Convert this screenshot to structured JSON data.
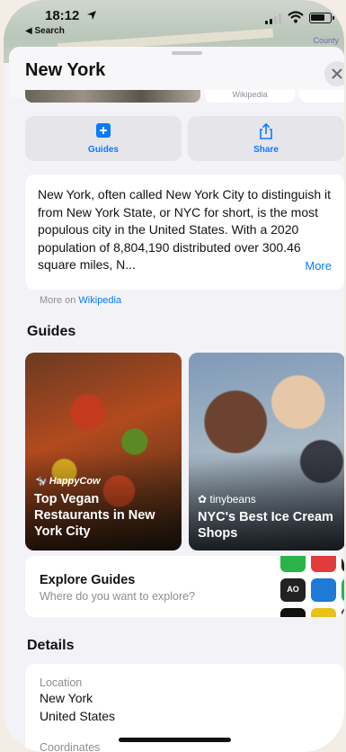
{
  "status_bar": {
    "time": "18:12",
    "back_label": "◀ Search"
  },
  "map": {
    "label": "County"
  },
  "place": {
    "title": "New York"
  },
  "photo_strip": {
    "credit": "Wikipedia"
  },
  "actions": [
    {
      "label": "Guides",
      "icon": "plus-square-icon"
    },
    {
      "label": "Share",
      "icon": "share-icon"
    }
  ],
  "about": {
    "text": "New York, often called New York City to distinguish it from New York State, or NYC for short, is the most populous city in the United States. With a 2020 population of 8,804,190 distributed over 300.46 square miles, N...",
    "more_label": "More",
    "source_prefix": "More on",
    "source_link": "Wikipedia"
  },
  "guides": {
    "heading": "Guides",
    "cards": [
      {
        "brand": "HappyCow",
        "title": "Top Vegan Restaurants in New York City"
      },
      {
        "brand": "tinybeans",
        "title": "NYC's Best Ice Cream Shops"
      }
    ],
    "explore": {
      "title": "Explore Guides",
      "subtitle": "Where do you want to explore?",
      "tile_labels": [
        "AO"
      ]
    }
  },
  "details": {
    "heading": "Details",
    "location_label": "Location",
    "location_line1": "New York",
    "location_line2": "United States",
    "next_label": "Coordinates"
  },
  "colors": {
    "accent": "#0a7aff",
    "background": "#f2f2f7",
    "card": "#ffffff"
  }
}
